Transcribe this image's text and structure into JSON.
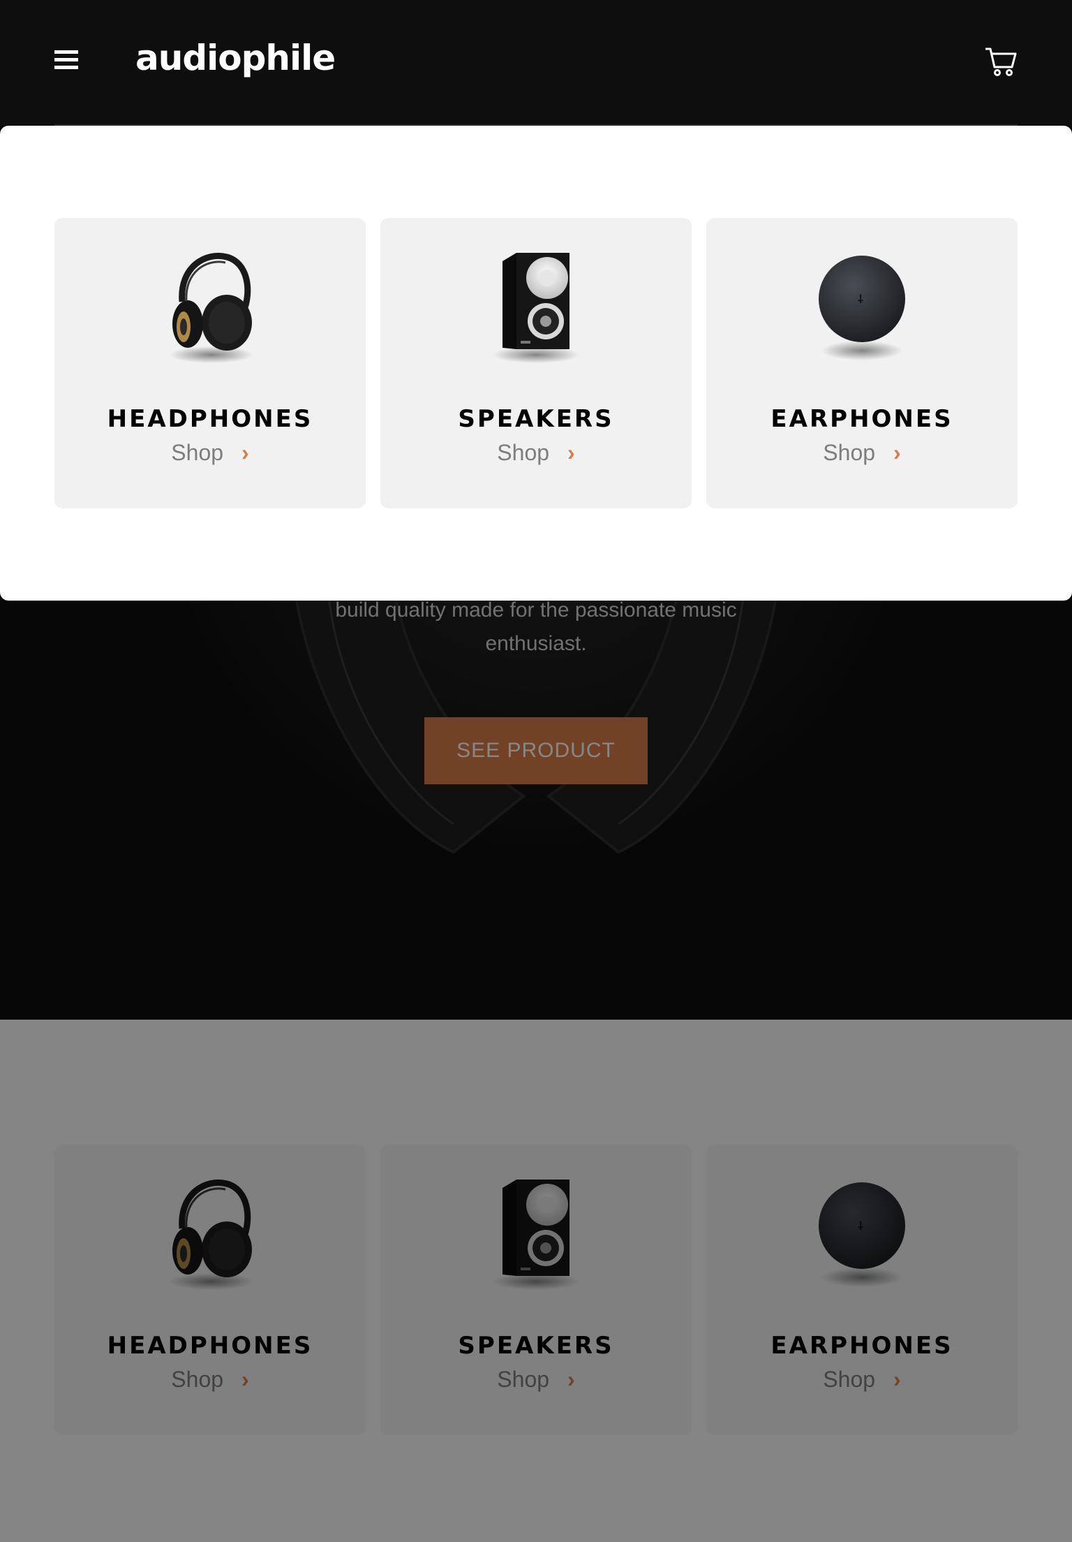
{
  "header": {
    "logo": "audiophile",
    "menu_icon": "hamburger-icon",
    "cart_icon": "cart-icon"
  },
  "hero": {
    "description_line1": "build quality made for the passionate music",
    "description_line2": "enthusiast.",
    "cta_label": "SEE PRODUCT"
  },
  "menu": {
    "categories": [
      {
        "name": "HEADPHONES",
        "shop_label": "Shop",
        "icon": "chevron-right-icon"
      },
      {
        "name": "SPEAKERS",
        "shop_label": "Shop",
        "icon": "chevron-right-icon"
      },
      {
        "name": "EARPHONES",
        "shop_label": "Shop",
        "icon": "chevron-right-icon"
      }
    ]
  },
  "categories": [
    {
      "name": "HEADPHONES",
      "shop_label": "Shop",
      "icon": "chevron-right-icon"
    },
    {
      "name": "SPEAKERS",
      "shop_label": "Shop",
      "icon": "chevron-right-icon"
    },
    {
      "name": "EARPHONES",
      "shop_label": "Shop",
      "icon": "chevron-right-icon"
    }
  ],
  "colors": {
    "accent": "#d87d4a",
    "dark": "#0e0e0e",
    "card": "#f1f1f1"
  }
}
